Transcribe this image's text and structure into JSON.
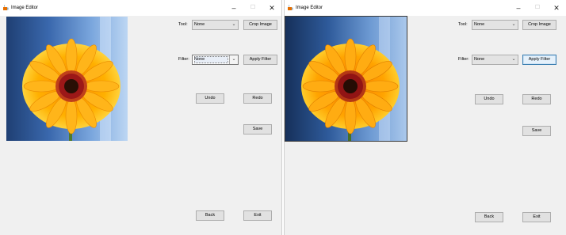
{
  "windows": [
    {
      "title": "Image Editor",
      "controls": {
        "minimize": "–",
        "maximize": "☐",
        "close": "✕"
      },
      "tool_label": "Tool:",
      "tool_value": "None",
      "filter_label": "Filter:",
      "filter_value": "None",
      "buttons": {
        "crop": "Crop Image",
        "apply_filter": "Apply Filter",
        "undo": "Undo",
        "redo": "Redo",
        "save": "Save",
        "back": "Back",
        "exit": "Exit"
      }
    },
    {
      "title": "Image Editor",
      "controls": {
        "minimize": "–",
        "maximize": "☐",
        "close": "✕"
      },
      "tool_label": "Tool:",
      "tool_value": "None",
      "filter_label": "Filter:",
      "filter_value": "None",
      "buttons": {
        "crop": "Crop Image",
        "apply_filter": "Apply Filter",
        "undo": "Undo",
        "redo": "Redo",
        "save": "Save",
        "back": "Back",
        "exit": "Exit"
      }
    }
  ],
  "icons": {
    "dropdown": "chevron-down-icon",
    "app": "java-cup-icon"
  },
  "colors": {
    "window_bg": "#f0f0f0",
    "button_bg": "#e1e1e1",
    "focus_border": "#3c7fb1"
  }
}
